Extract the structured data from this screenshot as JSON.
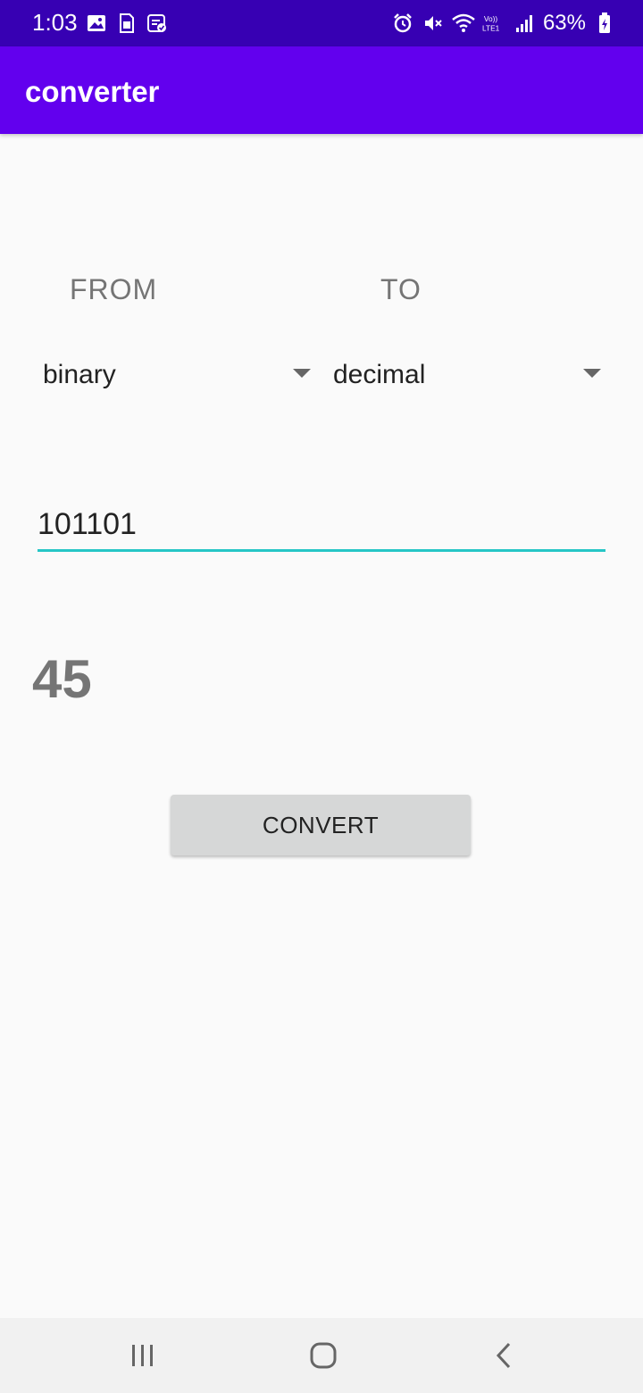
{
  "status_bar": {
    "time": "1:03",
    "battery": "63%",
    "left_icons": [
      "gallery-icon",
      "sim-icon",
      "task-icon"
    ],
    "right_icons": [
      "alarm-icon",
      "mute-icon",
      "wifi-icon",
      "volte-icon",
      "signal-icon",
      "battery-icon"
    ]
  },
  "app_bar": {
    "title": "converter"
  },
  "main": {
    "from_label": "FROM",
    "to_label": "TO",
    "from_selected": "binary",
    "to_selected": "decimal",
    "input_value": "101101",
    "result": "45",
    "convert_label": "CONVERT"
  },
  "colors": {
    "status_bar": "#3700b3",
    "app_bar": "#6200ee",
    "input_underline": "#26c6c6",
    "button_bg": "#d6d7d7"
  }
}
